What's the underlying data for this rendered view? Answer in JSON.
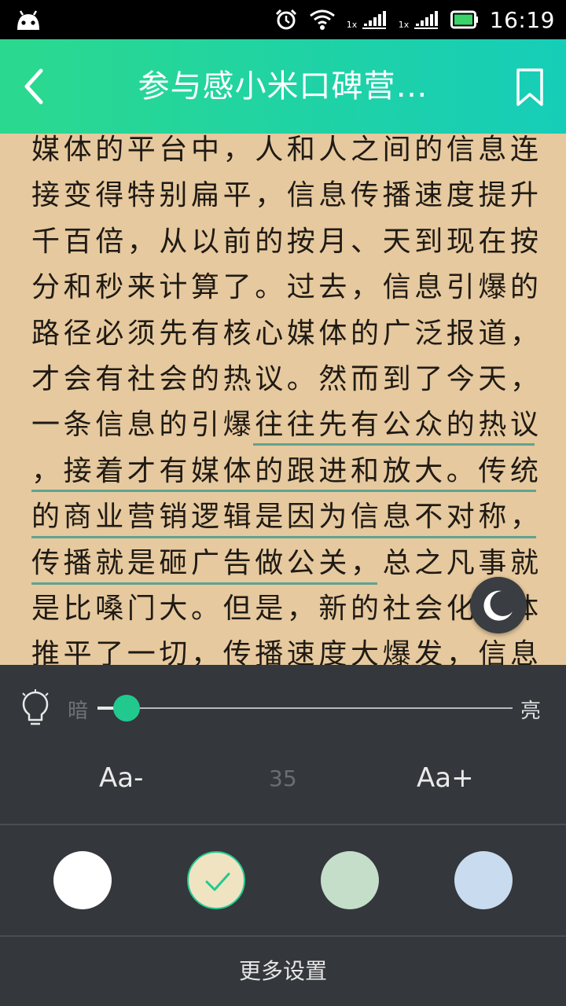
{
  "status_bar": {
    "time": "16:19",
    "sim1_label": "1x",
    "sim2_label": "1x",
    "icons": [
      "android-icon",
      "alarm-icon",
      "wifi-icon",
      "signal-icon",
      "signal-icon",
      "battery-icon"
    ]
  },
  "header": {
    "title": "参与感小米口碑营…",
    "back_icon": "chevron-left-icon",
    "bookmark_icon": "bookmark-icon"
  },
  "content": {
    "lines": [
      "媒体的平台中，人和人之间的信息连",
      "接变得特别扁平，信息传播速度提升",
      "千百倍，从以前的按月、天到现在按",
      "分和秒来计算了。过去，信息引爆的",
      "路径必须先有核心媒体的广泛报道，",
      "才会有社会的热议。然而到了今天，",
      "一条信息的引爆往往先有公众的热议",
      "，接着才有媒体的跟进和放大。传统",
      "的商业营销逻辑是因为信息不对称，",
      "传播就是砸广告做公关，总之凡事就",
      "是比嗓门大。但是，新的社会化媒体",
      "推平了一切，传播速度大爆发，信息"
    ],
    "highlight_color": "#5ea391",
    "background_color": "#e6c99e"
  },
  "night_mode": {
    "icon": "moon-icon"
  },
  "settings": {
    "brightness": {
      "icon": "lightbulb-icon",
      "dim_label": "暗",
      "bright_label": "亮",
      "level": 0.07
    },
    "font": {
      "decrease_label": "Aa-",
      "size": "35",
      "increase_label": "Aa+"
    },
    "themes": [
      {
        "name": "white",
        "color": "#ffffff",
        "selected": false
      },
      {
        "name": "parchment",
        "color": "#efe3c2",
        "selected": true
      },
      {
        "name": "green",
        "color": "#c5dec9",
        "selected": false
      },
      {
        "name": "blue",
        "color": "#c9dbef",
        "selected": false
      }
    ],
    "accent_color": "#21c98f",
    "more_label": "更多设置"
  }
}
